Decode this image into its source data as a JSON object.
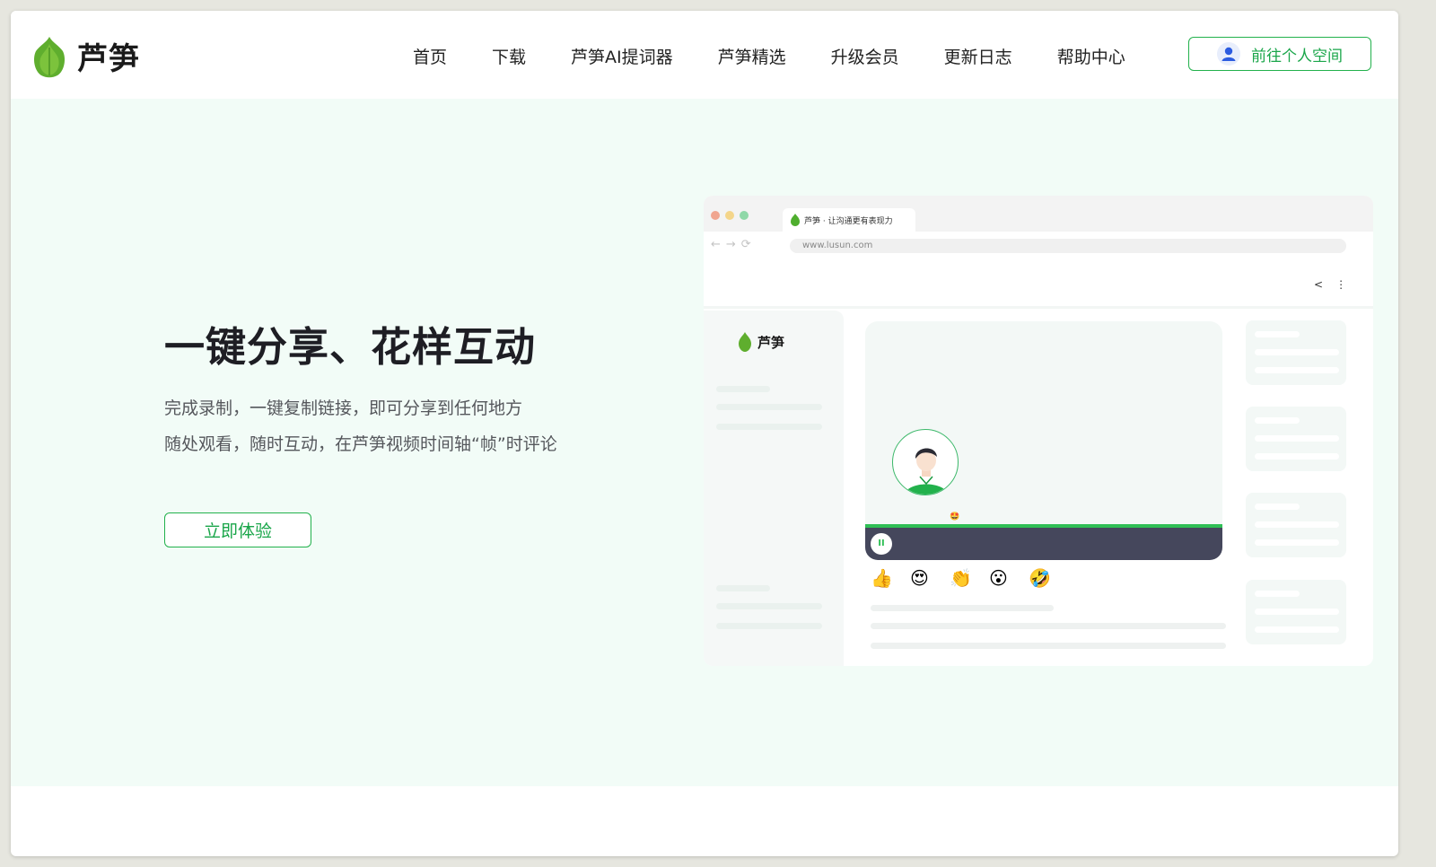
{
  "brand": {
    "name": "芦笋",
    "accent": "#22b14c",
    "logo_icon": "leaf-logo-icon"
  },
  "nav": {
    "items": [
      "首页",
      "下载",
      "芦笋AI提词器",
      "芦笋精选",
      "升级会员",
      "更新日志",
      "帮助中心"
    ],
    "personal_space": "前往个人空间",
    "personal_space_icon": "user-icon"
  },
  "hero": {
    "title": "一键分享、花样互动",
    "lines": [
      "完成录制，一键复制链接，即可分享到任何地方",
      "随处观看，随时互动，在芦笋视频时间轴“帧”时评论"
    ],
    "cta": "立即体验",
    "background": "#f2fcf7"
  },
  "mockup": {
    "tab_title": "芦笋 · 让沟通更有表现力",
    "url": "www.lusun.com",
    "sidebar_brand": "芦笋",
    "reactions": [
      "👍",
      "😍",
      "👏",
      "😮",
      "🤣"
    ],
    "pause_icon": "pause-icon",
    "share_icon": "share-icon",
    "more_icon": "more-vertical-icon"
  }
}
